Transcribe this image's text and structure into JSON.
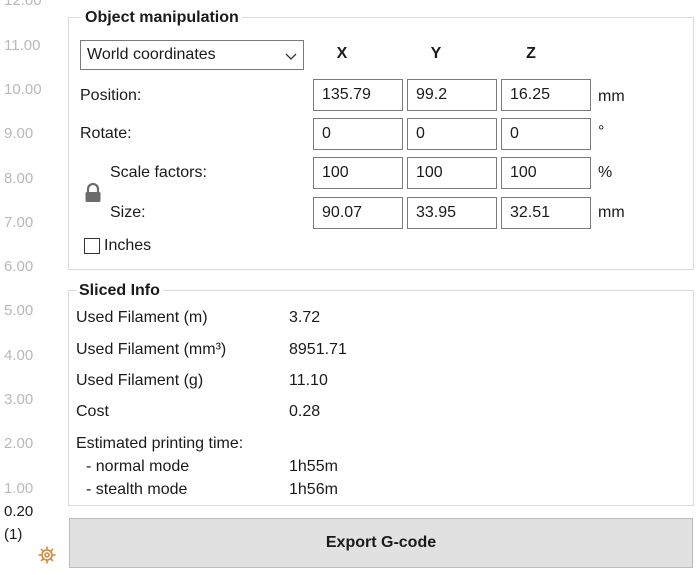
{
  "ruler": {
    "ticks": [
      "12.00",
      "11.00",
      "10.00",
      "9.00",
      "8.00",
      "7.00",
      "6.00",
      "5.00",
      "4.00",
      "3.00",
      "2.00",
      "1.00"
    ],
    "current_value": "0.20",
    "current_layer": "(1)"
  },
  "object_manipulation": {
    "title": "Object manipulation",
    "coordinate_mode": "World coordinates",
    "axes": [
      "X",
      "Y",
      "Z"
    ],
    "position": {
      "label": "Position:",
      "x": "135.79",
      "y": "99.2",
      "z": "16.25",
      "unit": "mm"
    },
    "rotate": {
      "label": "Rotate:",
      "x": "0",
      "y": "0",
      "z": "0",
      "unit": "°"
    },
    "scale": {
      "label": "Scale factors:",
      "x": "100",
      "y": "100",
      "z": "100",
      "unit": "%"
    },
    "size": {
      "label": "Size:",
      "x": "90.07",
      "y": "33.95",
      "z": "32.51",
      "unit": "mm"
    },
    "inches_label": "Inches",
    "inches_checked": false
  },
  "sliced_info": {
    "title": "Sliced Info",
    "filament_m_label": "Used Filament (m)",
    "filament_m": "3.72",
    "filament_mm3_label": "Used Filament (mm³)",
    "filament_mm3": "8951.71",
    "filament_g_label": "Used Filament (g)",
    "filament_g": "11.10",
    "cost_label": "Cost",
    "cost": "0.28",
    "est_time_label": "Estimated printing time:",
    "normal_mode_label": "- normal mode",
    "normal_mode": "1h55m",
    "stealth_mode_label": "- stealth mode",
    "stealth_mode": "1h56m"
  },
  "export_label": "Export G-code",
  "icons": {
    "lock": "lock-icon",
    "gear": "gear-icon",
    "dropdown": "chevron-down-icon"
  }
}
